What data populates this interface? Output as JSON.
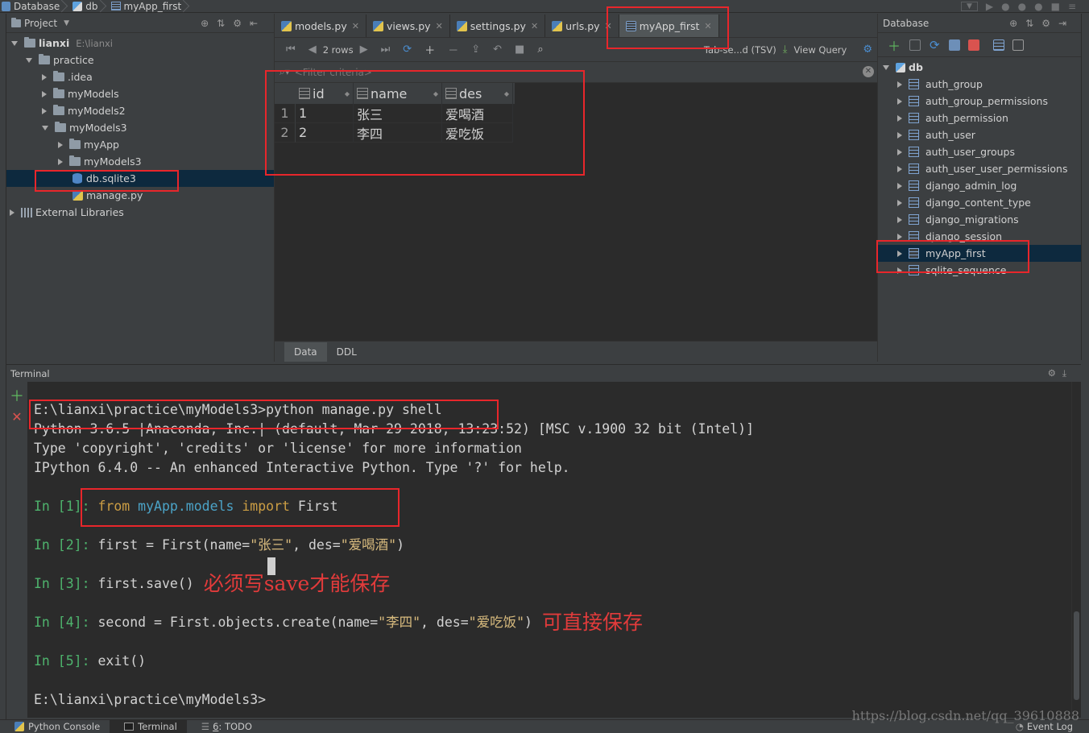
{
  "breadcrumb": [
    "Database",
    "db",
    "myApp_first"
  ],
  "project": {
    "header": "Project",
    "tree": [
      {
        "label": "lianxi",
        "path": "E:\\lianxi",
        "level": 0,
        "expanded": true
      },
      {
        "label": "practice",
        "level": 1,
        "expanded": true
      },
      {
        "label": ".idea",
        "level": 2,
        "expanded": false
      },
      {
        "label": "myModels",
        "level": 2,
        "expanded": false
      },
      {
        "label": "myModels2",
        "level": 2,
        "expanded": false
      },
      {
        "label": "myModels3",
        "level": 2,
        "expanded": true
      },
      {
        "label": "myApp",
        "level": 3,
        "expanded": false
      },
      {
        "label": "myModels3",
        "level": 3,
        "expanded": false
      },
      {
        "label": "db.sqlite3",
        "level": 3,
        "selected": true
      },
      {
        "label": "manage.py",
        "level": 3
      },
      {
        "label": "External Libraries",
        "level": 0,
        "expanded": false
      }
    ]
  },
  "editor": {
    "tabs": [
      {
        "label": "models.py"
      },
      {
        "label": "views.py"
      },
      {
        "label": "settings.py"
      },
      {
        "label": "urls.py"
      },
      {
        "label": "myApp_first",
        "active": true
      }
    ],
    "toolbar": {
      "rows": "2 rows",
      "format": "Tab-se...d (TSV)",
      "view_query": "View Query"
    },
    "filter_placeholder": "<Filter criteria>",
    "grid": {
      "columns": [
        "id",
        "name",
        "des"
      ],
      "rows": [
        {
          "index": "1",
          "id": "1",
          "name": "张三",
          "des": "爱喝酒"
        },
        {
          "index": "2",
          "id": "2",
          "name": "李四",
          "des": "爱吃饭"
        }
      ]
    },
    "bottom_tabs": [
      "Data",
      "DDL"
    ]
  },
  "database": {
    "header": "Database",
    "root": "db",
    "tables": [
      {
        "label": "auth_group"
      },
      {
        "label": "auth_group_permissions"
      },
      {
        "label": "auth_permission"
      },
      {
        "label": "auth_user"
      },
      {
        "label": "auth_user_groups"
      },
      {
        "label": "auth_user_user_permissions"
      },
      {
        "label": "django_admin_log"
      },
      {
        "label": "django_content_type"
      },
      {
        "label": "django_migrations"
      },
      {
        "label": "django_session"
      },
      {
        "label": "myApp_first",
        "selected": true
      },
      {
        "label": "sqlite_sequence"
      }
    ]
  },
  "terminal": {
    "header": "Terminal",
    "lines": {
      "cmd": "E:\\lianxi\\practice\\myModels3>python manage.py shell",
      "py_version": "Python 3.6.5 |Anaconda, Inc.| (default, Mar 29 2018, 13:23:52) [MSC v.1900 32 bit (Intel)]",
      "type_info": "Type 'copyright', 'credits' or 'license' for more information",
      "ipython": "IPython 6.4.0 -- An enhanced Interactive Python. Type '?' for help.",
      "in1_prompt": "In [1]: ",
      "in1_from": "from",
      "in1_module": "myApp.models",
      "in1_import": "import",
      "in1_name": "First",
      "in2_prompt": "In [2]: ",
      "in2_code_a": "first = First(name=",
      "in2_str1": "\"张三\"",
      "in2_code_b": ", des=",
      "in2_str2": "\"爱喝酒\"",
      "in2_code_c": ")",
      "in3_prompt": "In [3]: ",
      "in3_code": "first.save()",
      "in3_note": "必须写save才能保存",
      "in4_prompt": "In [4]: ",
      "in4_code_a": "second = First.objects.create(name=",
      "in4_str1": "\"李四\"",
      "in4_code_b": ", des=",
      "in4_str2": "\"爱吃饭\"",
      "in4_code_c": ")",
      "in4_note": "可直接保存",
      "in5_prompt": "In [5]: ",
      "in5_code": "exit()",
      "final_prompt": "E:\\lianxi\\practice\\myModels3>"
    }
  },
  "status_bar": {
    "python_console": "Python Console",
    "terminal": "Terminal",
    "todo_key": "6",
    "todo": ": TODO",
    "event_log": "Event Log"
  },
  "watermark": "https://blog.csdn.net/qq_39610888"
}
